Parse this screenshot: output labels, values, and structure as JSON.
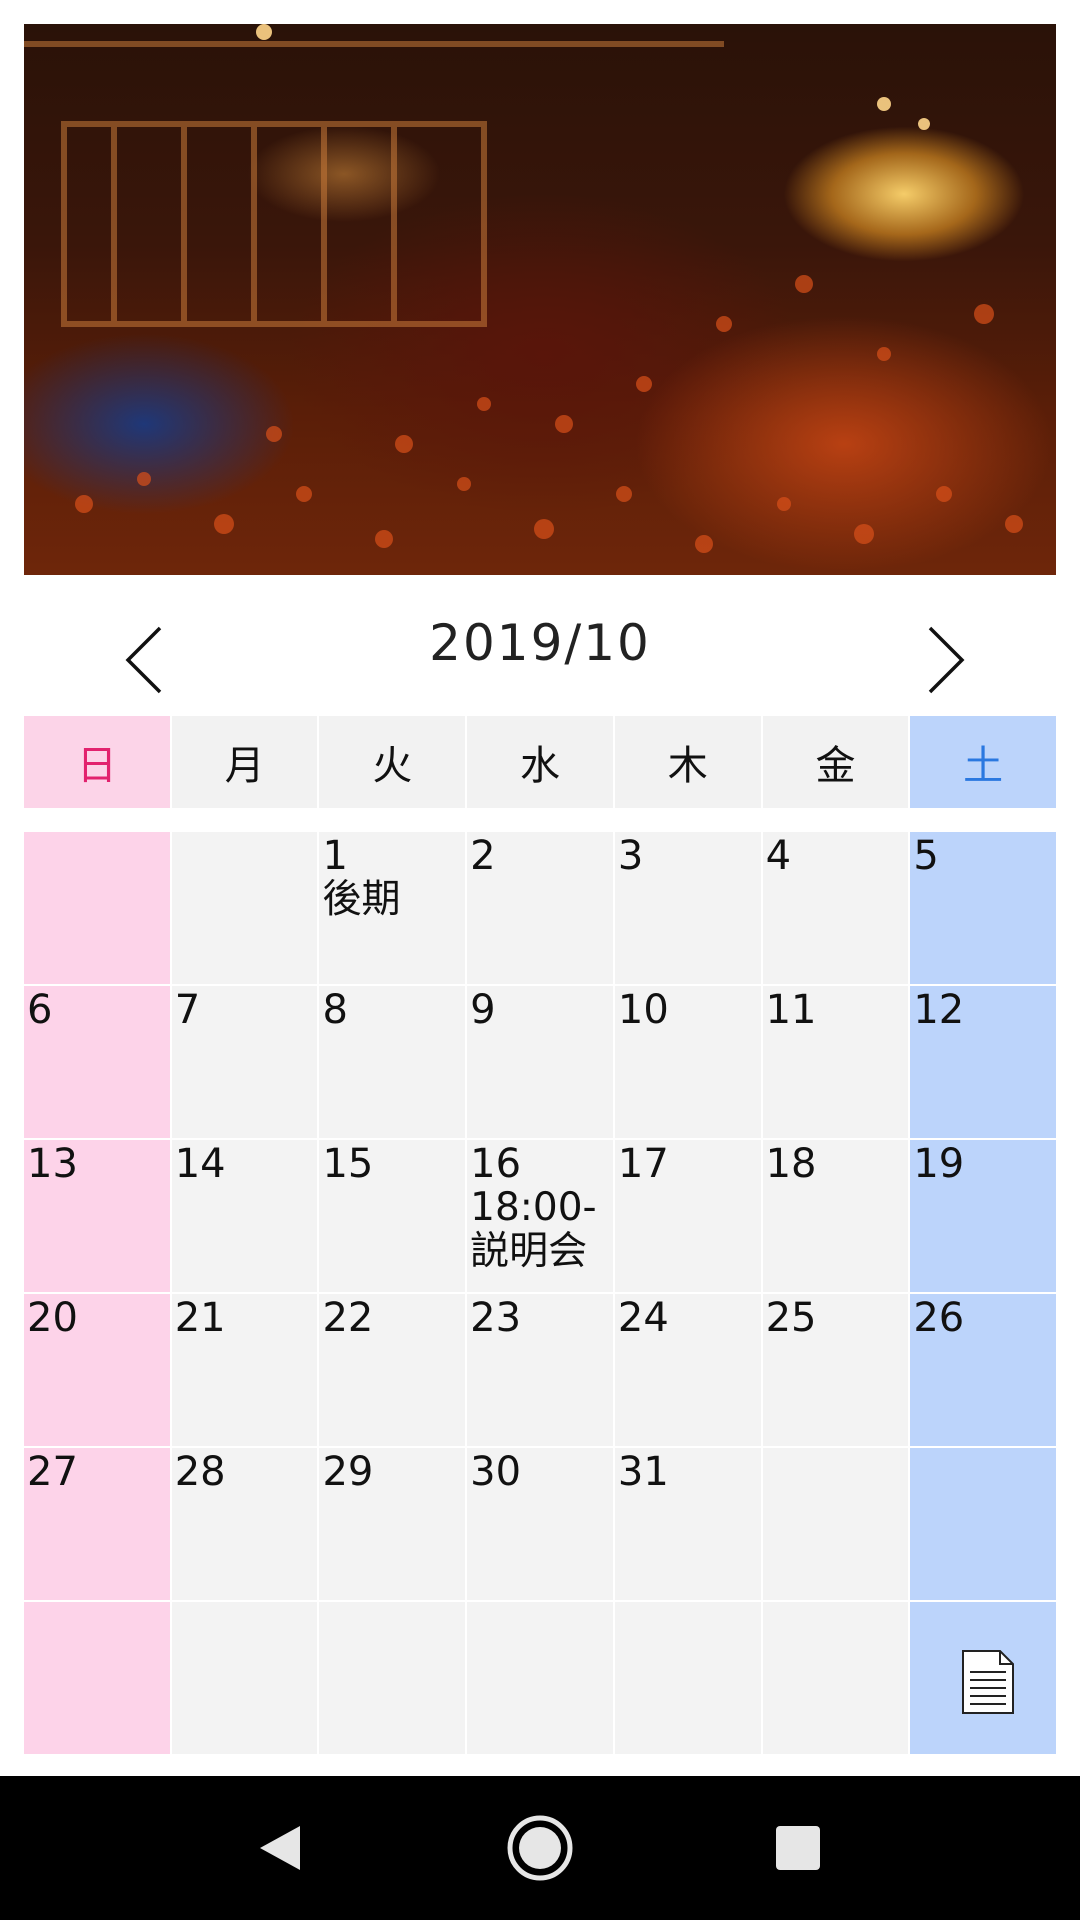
{
  "calendar": {
    "month_label": "2019/10",
    "weekdays": [
      "日",
      "月",
      "火",
      "水",
      "木",
      "金",
      "土"
    ],
    "weeks": [
      [
        {
          "d": "",
          "e": ""
        },
        {
          "d": "",
          "e": ""
        },
        {
          "d": "1",
          "e": "後期"
        },
        {
          "d": "2",
          "e": ""
        },
        {
          "d": "3",
          "e": ""
        },
        {
          "d": "4",
          "e": ""
        },
        {
          "d": "5",
          "e": ""
        }
      ],
      [
        {
          "d": "6",
          "e": ""
        },
        {
          "d": "7",
          "e": ""
        },
        {
          "d": "8",
          "e": ""
        },
        {
          "d": "9",
          "e": ""
        },
        {
          "d": "10",
          "e": ""
        },
        {
          "d": "11",
          "e": ""
        },
        {
          "d": "12",
          "e": ""
        }
      ],
      [
        {
          "d": "13",
          "e": ""
        },
        {
          "d": "14",
          "e": ""
        },
        {
          "d": "15",
          "e": ""
        },
        {
          "d": "16",
          "e": "18:00-\n説明会"
        },
        {
          "d": "17",
          "e": ""
        },
        {
          "d": "18",
          "e": ""
        },
        {
          "d": "19",
          "e": ""
        }
      ],
      [
        {
          "d": "20",
          "e": ""
        },
        {
          "d": "21",
          "e": ""
        },
        {
          "d": "22",
          "e": ""
        },
        {
          "d": "23",
          "e": ""
        },
        {
          "d": "24",
          "e": ""
        },
        {
          "d": "25",
          "e": ""
        },
        {
          "d": "26",
          "e": ""
        }
      ],
      [
        {
          "d": "27",
          "e": ""
        },
        {
          "d": "28",
          "e": ""
        },
        {
          "d": "29",
          "e": ""
        },
        {
          "d": "30",
          "e": ""
        },
        {
          "d": "31",
          "e": ""
        },
        {
          "d": "",
          "e": ""
        },
        {
          "d": "",
          "e": ""
        }
      ],
      [
        {
          "d": "",
          "e": ""
        },
        {
          "d": "",
          "e": ""
        },
        {
          "d": "",
          "e": ""
        },
        {
          "d": "",
          "e": ""
        },
        {
          "d": "",
          "e": ""
        },
        {
          "d": "",
          "e": ""
        },
        {
          "d": "",
          "e": ""
        }
      ]
    ]
  },
  "icons": {
    "prev": "chevron-left-icon",
    "next": "chevron-right-icon",
    "document": "document-icon",
    "nav_back": "back-triangle-icon",
    "nav_home": "home-circle-icon",
    "nav_recent": "recent-square-icon"
  },
  "colors": {
    "sunday_bg": "#fdd3e9",
    "sunday_text": "#e2226e",
    "saturday_bg": "#bcd4fb",
    "saturday_text": "#2a78e0",
    "weekday_bg": "#f3f3f3",
    "navbar_bg": "#000000"
  }
}
